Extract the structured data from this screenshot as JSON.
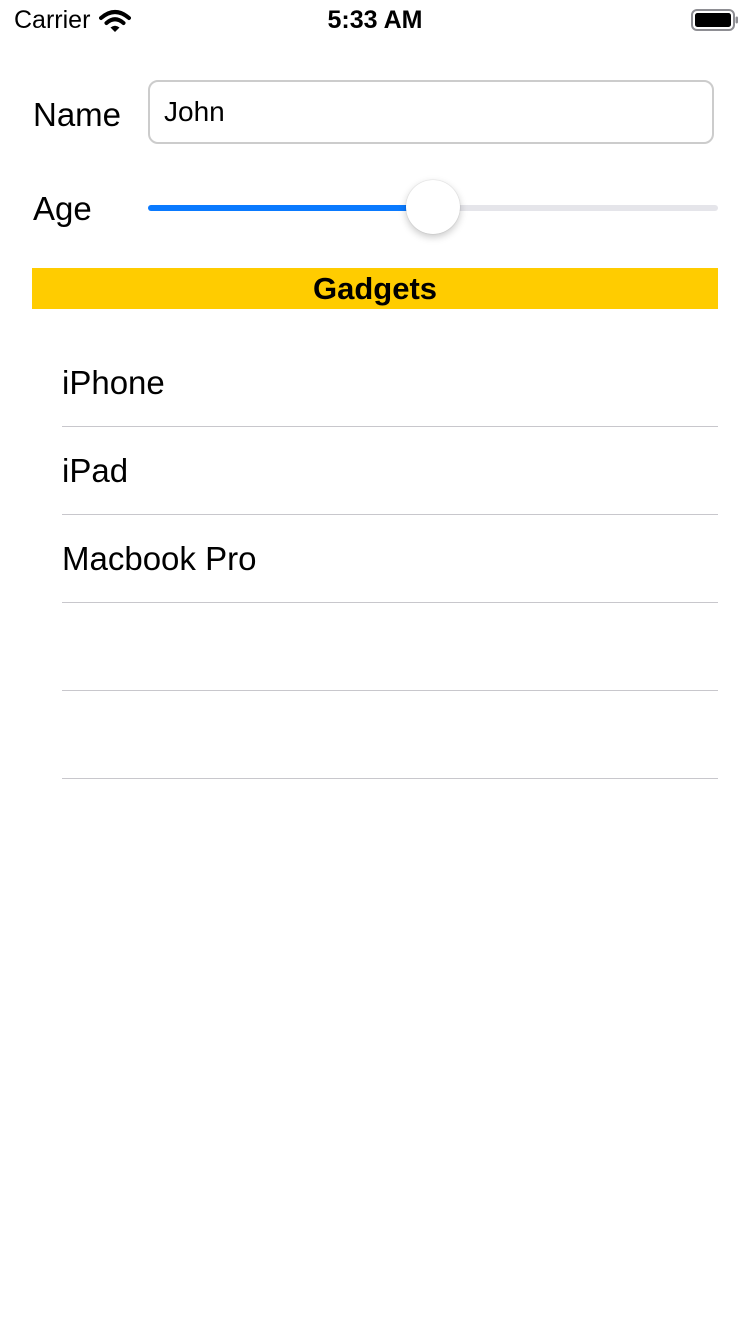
{
  "status_bar": {
    "carrier": "Carrier",
    "time": "5:33 AM",
    "wifi_icon": "wifi-icon",
    "battery_icon": "battery-full-icon"
  },
  "form": {
    "name_label": "Name",
    "name_value": "John",
    "age_label": "Age",
    "age_slider_fraction": 0.5
  },
  "section": {
    "title": "Gadgets",
    "background_color": "#ffcc00"
  },
  "list": {
    "items": [
      "iPhone",
      "iPad",
      "Macbook Pro",
      "",
      ""
    ]
  },
  "colors": {
    "accent": "#0a7aff",
    "separator": "#c8c7cc"
  }
}
